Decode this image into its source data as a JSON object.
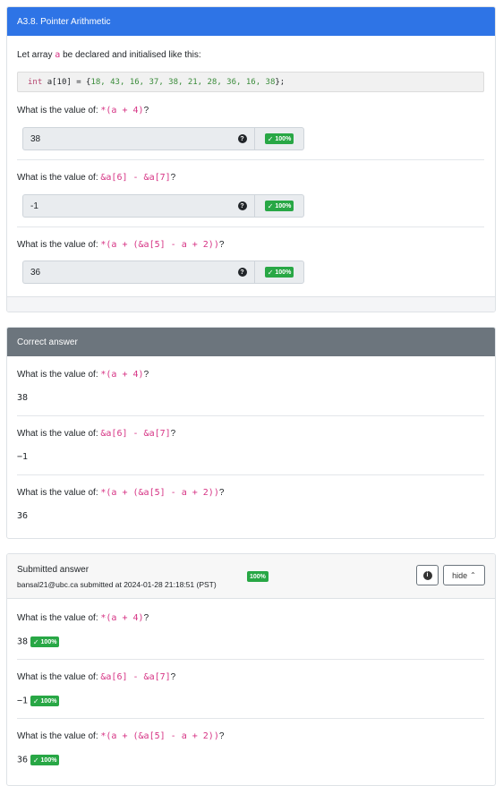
{
  "question_card": {
    "title": "A3.8. Pointer Arithmetic",
    "intro_text": "Let array",
    "intro_var": "a",
    "intro_rest": "be declared and initialised like this:",
    "code": {
      "type": "int",
      "decl": "a[10] = { ",
      "values": "18, 43, 16, 37, 38, 21, 28, 36, 16, 38",
      "end": " };"
    },
    "questions": [
      {
        "prefix": "What is the value of:",
        "expr": "*(a + 4)",
        "suffix": "?",
        "value": "38",
        "score": "100%"
      },
      {
        "prefix": "What is the value of:",
        "expr": "&a[6] - &a[7]",
        "suffix": "?",
        "value": "-1",
        "score": "100%"
      },
      {
        "prefix": "What is the value of:",
        "expr": "*(a + (&a[5] - a + 2))",
        "suffix": "?",
        "value": "36",
        "score": "100%"
      }
    ]
  },
  "correct_card": {
    "title": "Correct answer",
    "answers": [
      {
        "prefix": "What is the value of:",
        "expr": "*(a + 4)",
        "suffix": "?",
        "value": "38"
      },
      {
        "prefix": "What is the value of:",
        "expr": "&a[6] - &a[7]",
        "suffix": "?",
        "value": "−1"
      },
      {
        "prefix": "What is the value of:",
        "expr": "*(a + (&a[5] - a + 2))",
        "suffix": "?",
        "value": "36"
      }
    ]
  },
  "submitted_card": {
    "title": "Submitted answer",
    "subtitle": "bansal21@ubc.ca submitted at 2024-01-28 21:18:51 (PST)",
    "score": "100%",
    "hide_label": "hide",
    "answers": [
      {
        "prefix": "What is the value of:",
        "expr": "*(a + 4)",
        "suffix": "?",
        "value": "38",
        "score": "100%"
      },
      {
        "prefix": "What is the value of:",
        "expr": "&a[6] - &a[7]",
        "suffix": "?",
        "value": "−1",
        "score": "100%"
      },
      {
        "prefix": "What is the value of:",
        "expr": "*(a + (&a[5] - a + 2))",
        "suffix": "?",
        "value": "36",
        "score": "100%"
      }
    ]
  },
  "icons": {
    "help": "help-circle-icon",
    "check": "check-icon",
    "info": "info-circle-icon",
    "chevron": "chevron-up-icon"
  },
  "colors": {
    "primary_header": "#2e74e6",
    "secondary_header": "#6c757d",
    "success_badge": "#28a745",
    "code_pink": "#d63384"
  }
}
